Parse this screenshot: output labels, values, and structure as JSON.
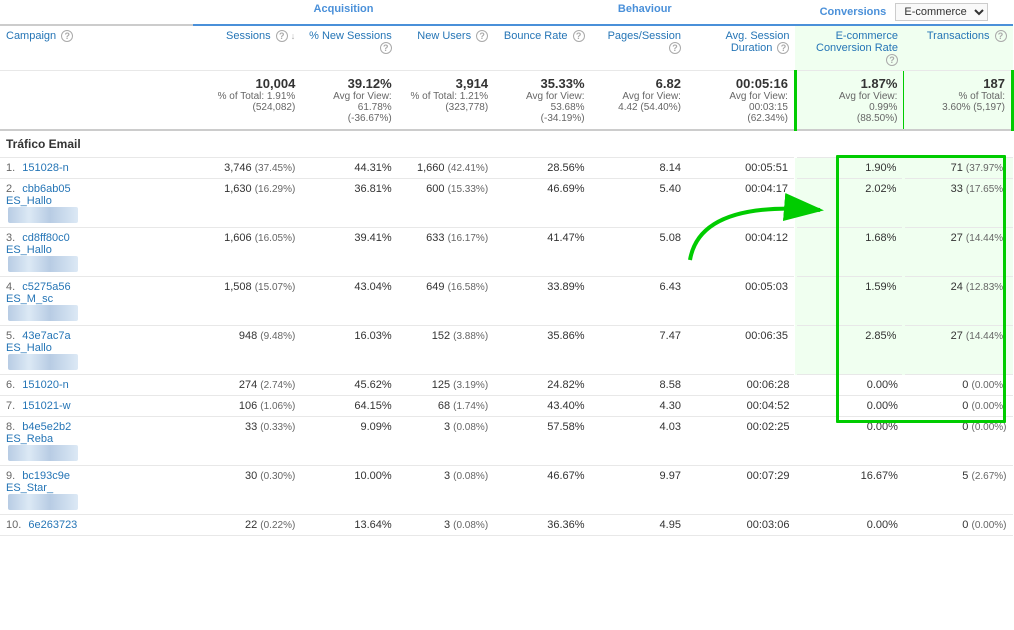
{
  "header": {
    "campaign_label": "Campaign",
    "help_icon": "?",
    "acquisition_label": "Acquisition",
    "behaviour_label": "Behaviour",
    "conversions_label": "Conversions",
    "ecommerce_dropdown": "E-commerce",
    "columns": {
      "sessions": "Sessions",
      "new_sessions": "% New Sessions",
      "new_users": "New Users",
      "bounce_rate": "Bounce Rate",
      "pages_session": "Pages/Session",
      "avg_session": "Avg. Session Duration",
      "ecommerce_rate": "E-commerce Conversion Rate",
      "transactions": "Transactions"
    }
  },
  "totals": {
    "sessions": "10,004",
    "sessions_sub1": "% of Total:",
    "sessions_sub2": "1.91%",
    "sessions_sub3": "(524,082)",
    "new_sessions": "39.12%",
    "new_sessions_sub": "Avg for View: 61.78% (-36.67%)",
    "new_users": "3,914",
    "new_users_sub1": "% of Total: 1.21%",
    "new_users_sub2": "(323,778)",
    "bounce_rate": "35.33%",
    "bounce_sub": "Avg for View: 53.68% (-34.19%)",
    "pages_session": "6.82",
    "pages_sub": "Avg for View: 4.42 (54.40%)",
    "avg_session": "00:05:16",
    "avg_sub": "Avg for View: 00:03:15 (62.34%)",
    "ecommerce_rate": "1.87%",
    "ecommerce_sub": "Avg for View: 0.99% (88.50%)",
    "transactions": "187",
    "transactions_sub1": "% of Total:",
    "transactions_sub2": "3.60% (5,197)"
  },
  "section_name": "Tráfico Email",
  "rows": [
    {
      "num": "1.",
      "name": "151028-n",
      "has_extra": false,
      "sessions": "3,746",
      "sessions_pct": "(37.45%)",
      "new_sessions": "44.31%",
      "new_users": "1,660",
      "new_users_pct": "(42.41%)",
      "bounce_rate": "28.56%",
      "pages_session": "8.14",
      "avg_session": "00:05:51",
      "ecommerce_rate": "1.90%",
      "transactions": "71",
      "transactions_pct": "(37.97%)"
    },
    {
      "num": "2.",
      "name": "cbb6ab05",
      "name2": "ES_Hallo",
      "has_extra": true,
      "sessions": "1,630",
      "sessions_pct": "(16.29%)",
      "new_sessions": "36.81%",
      "new_users": "600",
      "new_users_pct": "(15.33%)",
      "bounce_rate": "46.69%",
      "pages_session": "5.40",
      "avg_session": "00:04:17",
      "ecommerce_rate": "2.02%",
      "transactions": "33",
      "transactions_pct": "(17.65%)"
    },
    {
      "num": "3.",
      "name": "cd8ff80c0",
      "name2": "ES_Hallo",
      "has_extra": true,
      "sessions": "1,606",
      "sessions_pct": "(16.05%)",
      "new_sessions": "39.41%",
      "new_users": "633",
      "new_users_pct": "(16.17%)",
      "bounce_rate": "41.47%",
      "pages_session": "5.08",
      "avg_session": "00:04:12",
      "ecommerce_rate": "1.68%",
      "transactions": "27",
      "transactions_pct": "(14.44%)"
    },
    {
      "num": "4.",
      "name": "c5275a56",
      "name2": "ES_M_sc",
      "has_extra": true,
      "sessions": "1,508",
      "sessions_pct": "(15.07%)",
      "new_sessions": "43.04%",
      "new_users": "649",
      "new_users_pct": "(16.58%)",
      "bounce_rate": "33.89%",
      "pages_session": "6.43",
      "avg_session": "00:05:03",
      "ecommerce_rate": "1.59%",
      "transactions": "24",
      "transactions_pct": "(12.83%)"
    },
    {
      "num": "5.",
      "name": "43e7ac7a",
      "name2": "ES_Hallo",
      "has_extra": true,
      "sessions": "948",
      "sessions_pct": "(9.48%)",
      "new_sessions": "16.03%",
      "new_users": "152",
      "new_users_pct": "(3.88%)",
      "bounce_rate": "35.86%",
      "pages_session": "7.47",
      "avg_session": "00:06:35",
      "ecommerce_rate": "2.85%",
      "transactions": "27",
      "transactions_pct": "(14.44%)"
    },
    {
      "num": "6.",
      "name": "151020-n",
      "has_extra": false,
      "sessions": "274",
      "sessions_pct": "(2.74%)",
      "new_sessions": "45.62%",
      "new_users": "125",
      "new_users_pct": "(3.19%)",
      "bounce_rate": "24.82%",
      "pages_session": "8.58",
      "avg_session": "00:06:28",
      "ecommerce_rate": "0.00%",
      "transactions": "0",
      "transactions_pct": "(0.00%)"
    },
    {
      "num": "7.",
      "name": "151021-w",
      "has_extra": false,
      "sessions": "106",
      "sessions_pct": "(1.06%)",
      "new_sessions": "64.15%",
      "new_users": "68",
      "new_users_pct": "(1.74%)",
      "bounce_rate": "43.40%",
      "pages_session": "4.30",
      "avg_session": "00:04:52",
      "ecommerce_rate": "0.00%",
      "transactions": "0",
      "transactions_pct": "(0.00%)"
    },
    {
      "num": "8.",
      "name": "b4e5e2b2",
      "name2": "ES_Reba",
      "has_extra": true,
      "sessions": "33",
      "sessions_pct": "(0.33%)",
      "new_sessions": "9.09%",
      "new_users": "3",
      "new_users_pct": "(0.08%)",
      "bounce_rate": "57.58%",
      "pages_session": "4.03",
      "avg_session": "00:02:25",
      "ecommerce_rate": "0.00%",
      "transactions": "0",
      "transactions_pct": "(0.00%)"
    },
    {
      "num": "9.",
      "name": "bc193c9e",
      "name2": "ES_Star_",
      "has_extra": true,
      "sessions": "30",
      "sessions_pct": "(0.30%)",
      "new_sessions": "10.00%",
      "new_users": "3",
      "new_users_pct": "(0.08%)",
      "bounce_rate": "46.67%",
      "pages_session": "9.97",
      "avg_session": "00:07:29",
      "ecommerce_rate": "16.67%",
      "transactions": "5",
      "transactions_pct": "(2.67%)"
    },
    {
      "num": "10.",
      "name": "6e263723",
      "has_extra": false,
      "sessions": "22",
      "sessions_pct": "(0.22%)",
      "new_sessions": "13.64%",
      "new_users": "3",
      "new_users_pct": "(0.08%)",
      "bounce_rate": "36.36%",
      "pages_session": "4.95",
      "avg_session": "00:03:06",
      "ecommerce_rate": "0.00%",
      "transactions": "0",
      "transactions_pct": "(0.00%)"
    }
  ]
}
